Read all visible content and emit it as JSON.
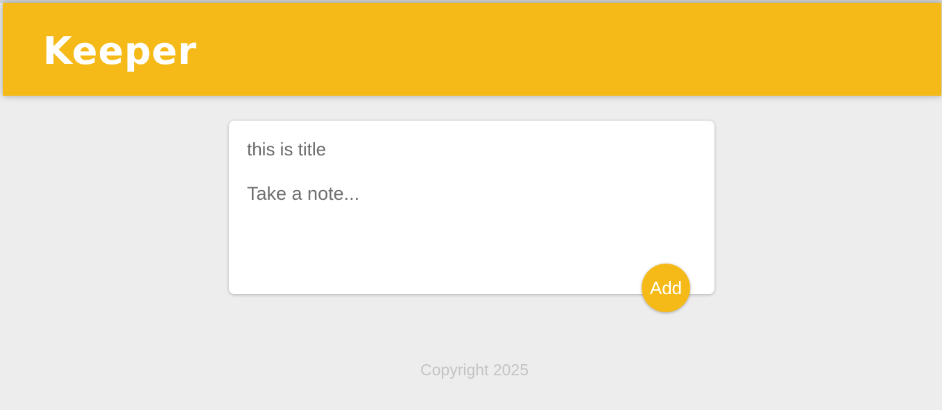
{
  "header": {
    "title": "Keeper"
  },
  "note_form": {
    "title_value": "this is title",
    "content_placeholder": "Take a note...",
    "add_label": "Add"
  },
  "footer": {
    "copyright": "Copyright 2025"
  },
  "colors": {
    "accent": "#f5ba18",
    "background": "#ededed",
    "card": "#ffffff",
    "footer_text": "#c4c4c4"
  }
}
